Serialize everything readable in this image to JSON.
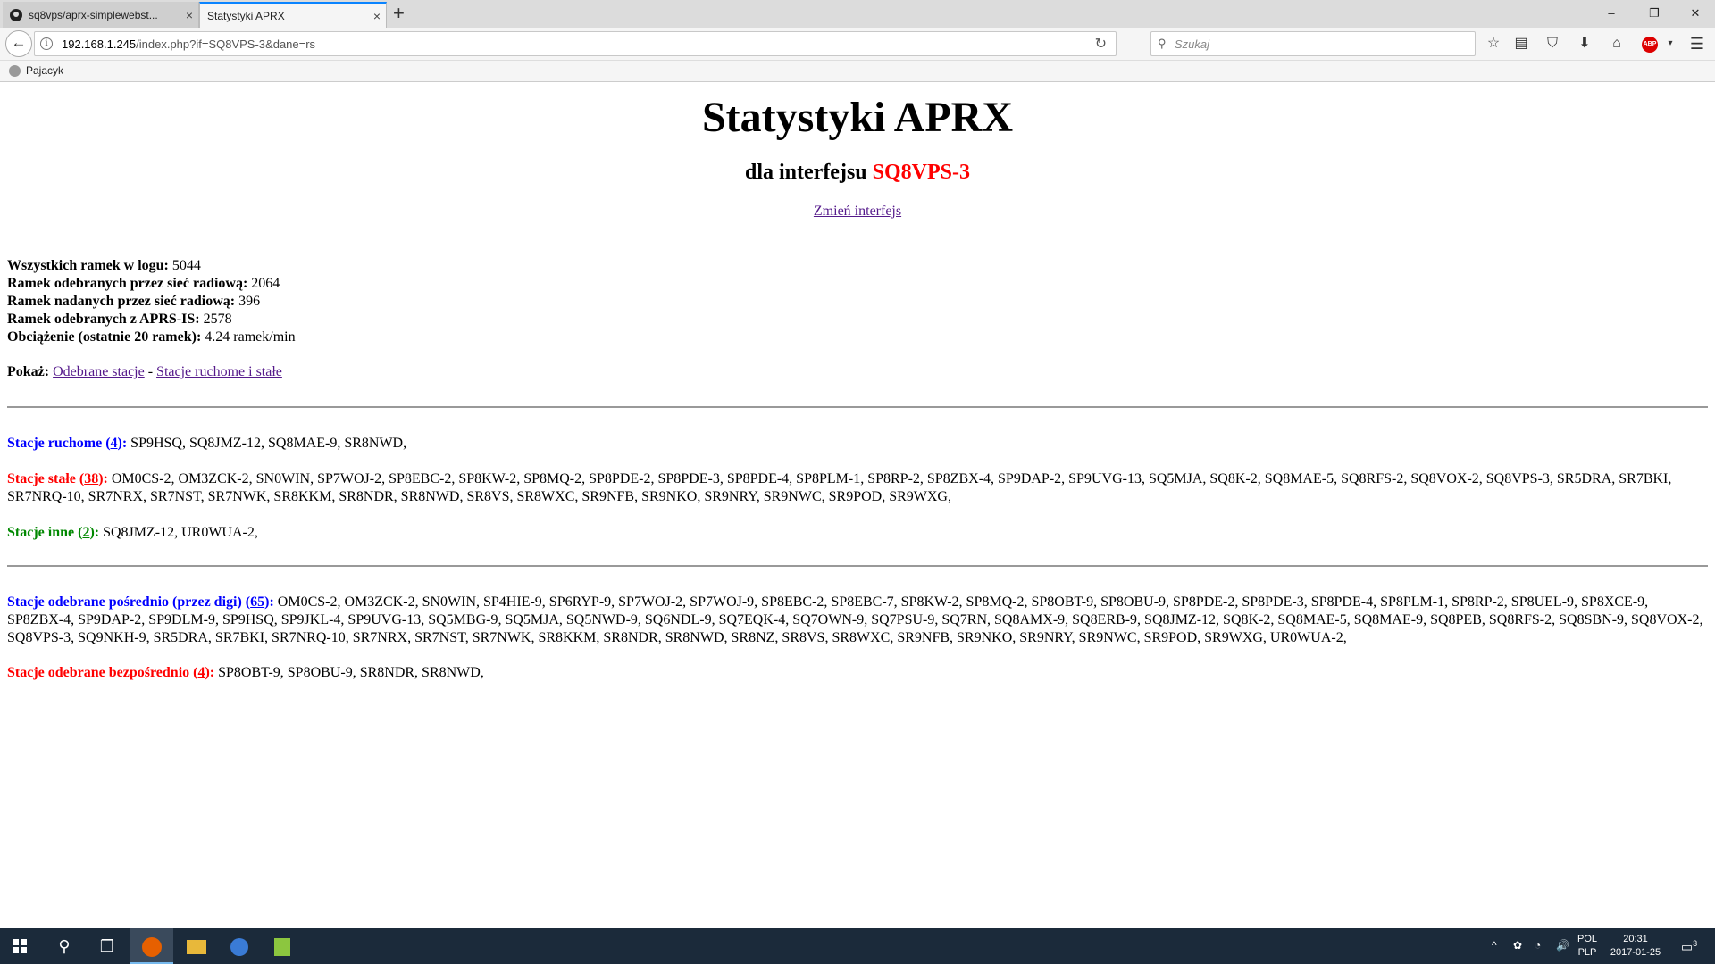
{
  "browser": {
    "tabs": [
      {
        "title": "sq8vps/aprx-simplewebst...",
        "close": "×"
      },
      {
        "title": "Statystyki APRX",
        "close": "×"
      }
    ],
    "new_tab": "+",
    "window_controls": {
      "minimize": "–",
      "maximize": "❐",
      "close": "✕"
    },
    "url_host": "192.168.1.245",
    "url_path": "/index.php?if=SQ8VPS-3&dane=rs",
    "search_placeholder": "Szukaj",
    "bookmark": "Pajacyk"
  },
  "page": {
    "title": "Statystyki APRX",
    "subtitle_prefix": "dla interfejsu",
    "interface": "SQ8VPS-3",
    "change_link": "Zmień interfejs",
    "stats": [
      {
        "label": "Wszystkich ramek w logu:",
        "value": "5044"
      },
      {
        "label": "Ramek odebranych przez sieć radiową:",
        "value": "2064"
      },
      {
        "label": "Ramek nadanych przez sieć radiową:",
        "value": "396"
      },
      {
        "label": "Ramek odebranych z APRS-IS:",
        "value": "2578"
      },
      {
        "label": "Obciążenie (ostatnie 20 ramek):",
        "value": "4.24 ramek/min"
      }
    ],
    "show": {
      "label": "Pokaż:",
      "link1": "Odebrane stacje",
      "sep": "-",
      "link2": "Stacje ruchome i stałe"
    },
    "mobile": {
      "label": "Stacje ruchome",
      "count": "4",
      "list": "SP9HSQ, SQ8JMZ-12, SQ8MAE-9, SR8NWD,"
    },
    "fixed": {
      "label": "Stacje stałe",
      "count": "38",
      "list": "OM0CS-2, OM3ZCK-2, SN0WIN, SP7WOJ-2, SP8EBC-2, SP8KW-2, SP8MQ-2, SP8PDE-2, SP8PDE-3, SP8PDE-4, SP8PLM-1, SP8RP-2, SP8ZBX-4, SP9DAP-2, SP9UVG-13, SQ5MJA, SQ8K-2, SQ8MAE-5, SQ8RFS-2, SQ8VOX-2, SQ8VPS-3, SR5DRA, SR7BKI, SR7NRQ-10, SR7NRX, SR7NST, SR7NWK, SR8KKM, SR8NDR, SR8NWD, SR8VS, SR8WXC, SR9NFB, SR9NKO, SR9NRY, SR9NWC, SR9POD, SR9WXG,"
    },
    "other": {
      "label": "Stacje inne",
      "count": "2",
      "list": "SQ8JMZ-12, UR0WUA-2,"
    },
    "indirect": {
      "label": "Stacje odebrane pośrednio (przez digi)",
      "count": "65",
      "list": "OM0CS-2, OM3ZCK-2, SN0WIN, SP4HIE-9, SP6RYP-9, SP7WOJ-2, SP7WOJ-9, SP8EBC-2, SP8EBC-7, SP8KW-2, SP8MQ-2, SP8OBT-9, SP8OBU-9, SP8PDE-2, SP8PDE-3, SP8PDE-4, SP8PLM-1, SP8RP-2, SP8UEL-9, SP8XCE-9, SP8ZBX-4, SP9DAP-2, SP9DLM-9, SP9HSQ, SP9JKL-4, SP9UVG-13, SQ5MBG-9, SQ5MJA, SQ5NWD-9, SQ6NDL-9, SQ7EQK-4, SQ7OWN-9, SQ7PSU-9, SQ7RN, SQ8AMX-9, SQ8ERB-9, SQ8JMZ-12, SQ8K-2, SQ8MAE-5, SQ8MAE-9, SQ8PEB, SQ8RFS-2, SQ8SBN-9, SQ8VOX-2, SQ8VPS-3, SQ9NKH-9, SR5DRA, SR7BKI, SR7NRQ-10, SR7NRX, SR7NST, SR7NWK, SR8KKM, SR8NDR, SR8NWD, SR8NZ, SR8VS, SR8WXC, SR9NFB, SR9NKO, SR9NRY, SR9NWC, SR9POD, SR9WXG, UR0WUA-2,"
    },
    "direct": {
      "label": "Stacje odebrane bezpośrednio",
      "count": "4",
      "list": "SP8OBT-9, SP8OBU-9, SR8NDR, SR8NWD,"
    }
  },
  "taskbar": {
    "lang_top": "POL",
    "lang_bottom": "PLP",
    "time": "20:31",
    "date": "2017-01-25",
    "notif_count": "3"
  }
}
